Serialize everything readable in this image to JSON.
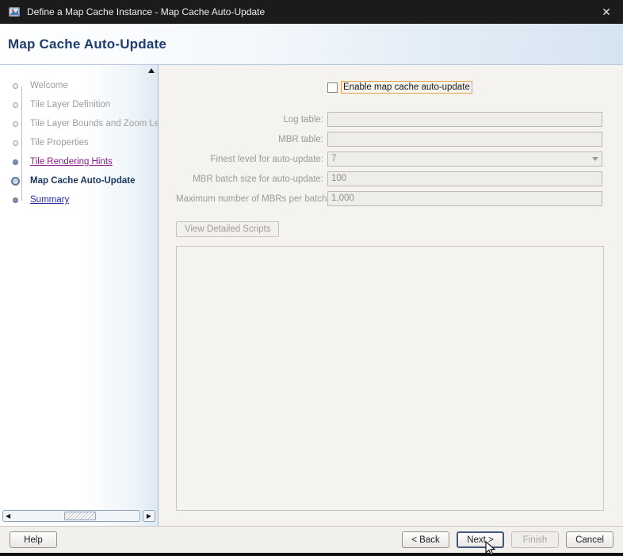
{
  "window": {
    "title": "Define a Map Cache Instance - Map Cache Auto-Update",
    "close_glyph": "✕"
  },
  "header": {
    "title": "Map Cache Auto-Update"
  },
  "sidebar": {
    "steps": [
      {
        "label": "Welcome",
        "state": "pending"
      },
      {
        "label": "Tile Layer Definition",
        "state": "pending"
      },
      {
        "label": "Tile Layer Bounds and Zoom Level",
        "state": "pending"
      },
      {
        "label": "Tile Properties",
        "state": "pending"
      },
      {
        "label": "Tile Rendering Hints",
        "state": "visited-link"
      },
      {
        "label": "Map Cache Auto-Update",
        "state": "current"
      },
      {
        "label": "Summary",
        "state": "link"
      }
    ],
    "scroll": {
      "left_glyph": "◀",
      "right_glyph": "▶"
    }
  },
  "form": {
    "enable_checkbox": {
      "label": "Enable map cache auto-update",
      "checked": false
    },
    "fields": [
      {
        "label": "Log table:",
        "value": "",
        "type": "text",
        "enabled": false
      },
      {
        "label": "MBR table:",
        "value": "",
        "type": "text",
        "enabled": false
      },
      {
        "label": "Finest level for auto-update:",
        "value": "7",
        "type": "select",
        "enabled": false
      },
      {
        "label": "MBR batch size for auto-update:",
        "value": "100",
        "type": "text",
        "enabled": false
      },
      {
        "label": "Maximum number of MBRs per batch:",
        "value": "1,000",
        "type": "text",
        "enabled": false
      }
    ],
    "view_scripts_label": "View Detailed Scripts"
  },
  "footer": {
    "help": "Help",
    "back": "< Back",
    "next": "Next >",
    "finish": "Finish",
    "cancel": "Cancel"
  },
  "colors": {
    "titlebar_bg": "#1b1b1b",
    "header_title": "#1f3d70",
    "checkbox_focus_ring": "#e8a33d",
    "visited_link": "#8a2089",
    "link": "#2b2ba0",
    "current_step": "#19365e"
  }
}
